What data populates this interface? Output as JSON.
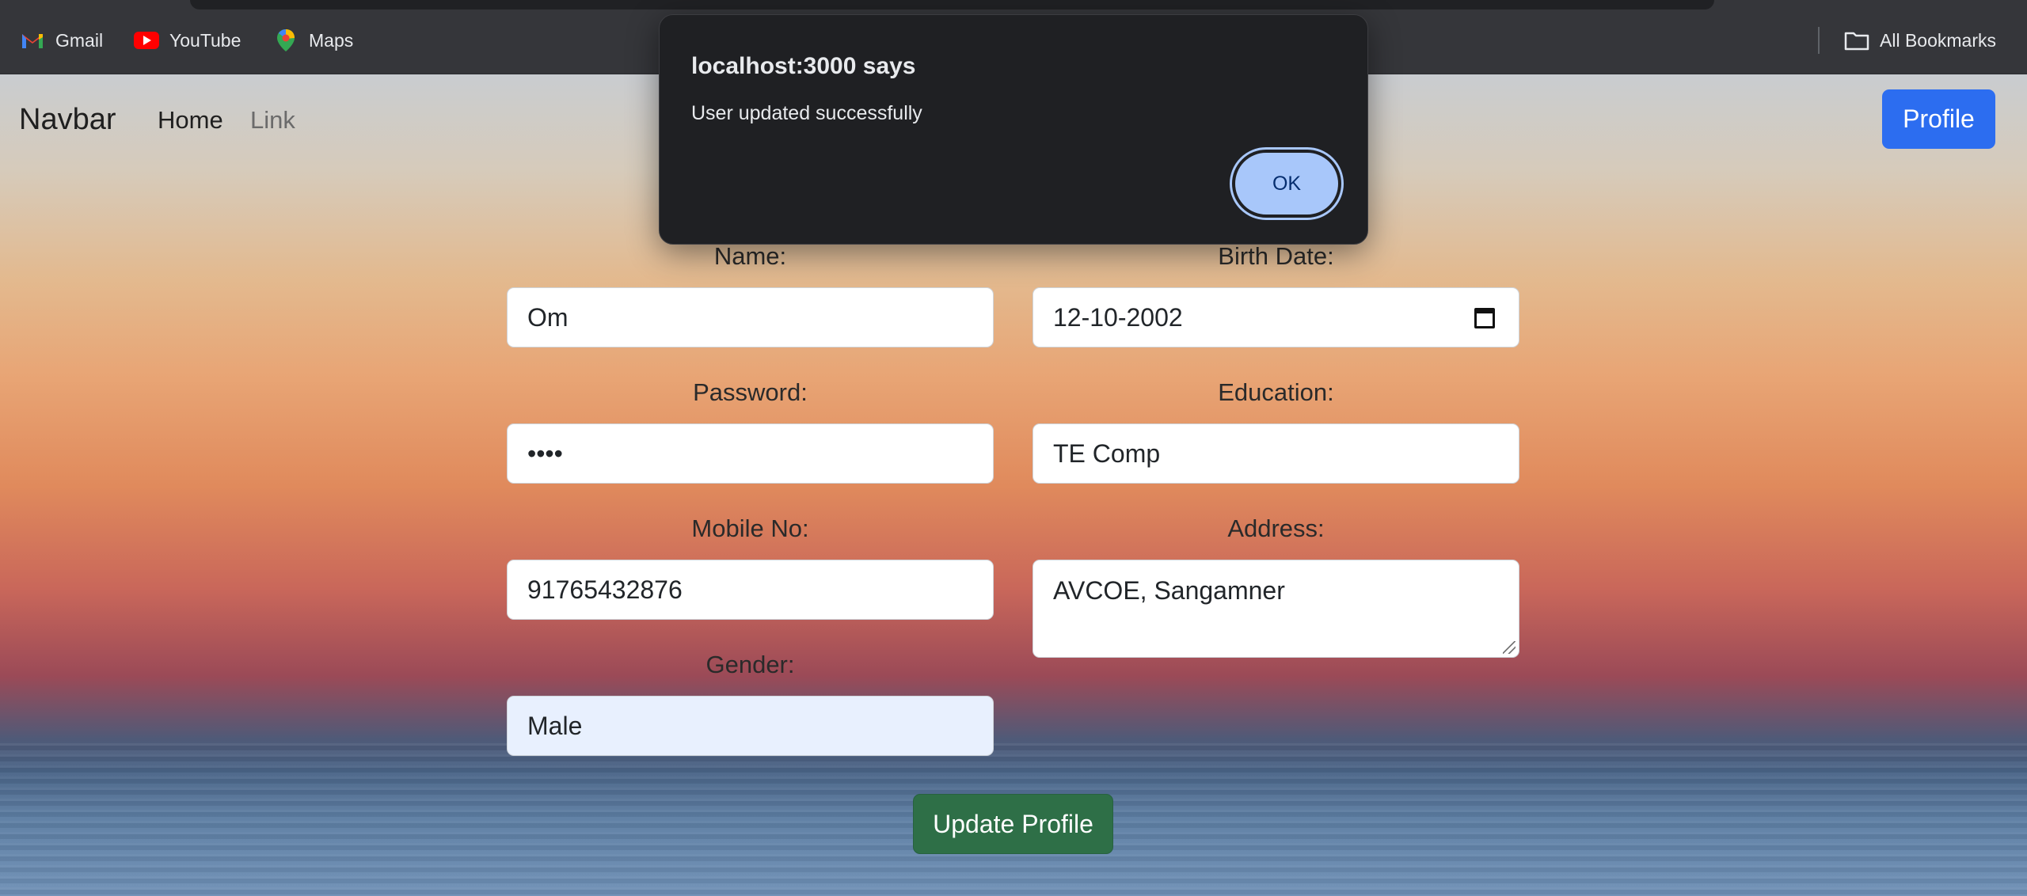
{
  "bookmarks": {
    "items": [
      {
        "label": "Gmail",
        "icon": "gmail-icon"
      },
      {
        "label": "YouTube",
        "icon": "youtube-icon"
      },
      {
        "label": "Maps",
        "icon": "maps-icon"
      }
    ],
    "all_bookmarks_label": "All Bookmarks"
  },
  "navbar": {
    "brand": "Navbar",
    "links": [
      "Home",
      "Link"
    ],
    "profile_label": "Profile"
  },
  "form": {
    "name_label": "Name:",
    "name_value": "Om",
    "birth_label": "Birth Date:",
    "birth_value": "12-10-2002",
    "password_label": "Password:",
    "password_value": "••••",
    "education_label": "Education:",
    "education_value": "TE Comp",
    "mobile_label": "Mobile No:",
    "mobile_value": "91765432876",
    "address_label": "Address:",
    "address_value": "AVCOE, Sangamner",
    "gender_label": "Gender:",
    "gender_value": "Male",
    "submit_label": "Update Profile"
  },
  "dialog": {
    "title": "localhost:3000 says",
    "message": "User updated successfully",
    "ok_label": "OK"
  },
  "colors": {
    "primary": "#2c6df0",
    "success": "#2e6f47",
    "dialog_bg": "#1f2023",
    "dialog_button": "#a8c7fa"
  }
}
